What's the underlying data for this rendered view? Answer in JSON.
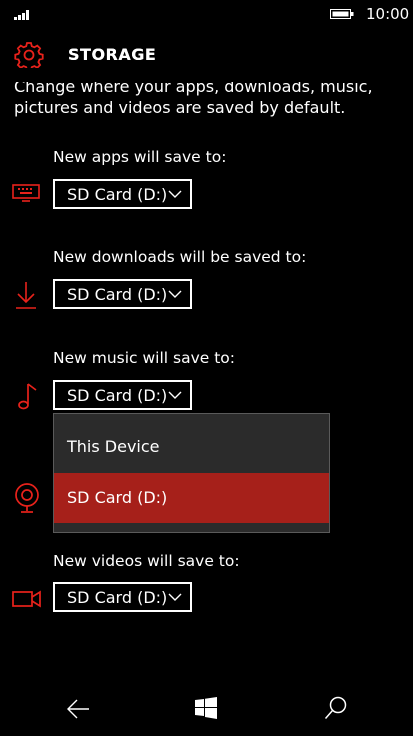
{
  "status": {
    "time": "10:00"
  },
  "header": {
    "title": "STORAGE"
  },
  "description": "Change where your apps, downloads, music, pictures and videos are saved by default.",
  "settings": [
    {
      "label": "New apps will save to:",
      "value": "SD Card (D:)",
      "icon": "keyboard-icon"
    },
    {
      "label": "New downloads will be saved to:",
      "value": "SD Card (D:)",
      "icon": "download-icon"
    },
    {
      "label": "New music will save to:",
      "value": "SD Card (D:)",
      "icon": "music-note-icon"
    },
    {
      "label": "",
      "value": "",
      "icon": "webcam-icon"
    },
    {
      "label": "New videos will save to:",
      "value": "SD Card (D:)",
      "icon": "video-camera-icon"
    }
  ],
  "dropdown": {
    "options": [
      "This Device",
      "SD Card (D:)"
    ],
    "selected_index": 1
  },
  "colors": {
    "accent": "#e8221b",
    "selected_bg": "#a6201a",
    "background": "#000000"
  }
}
